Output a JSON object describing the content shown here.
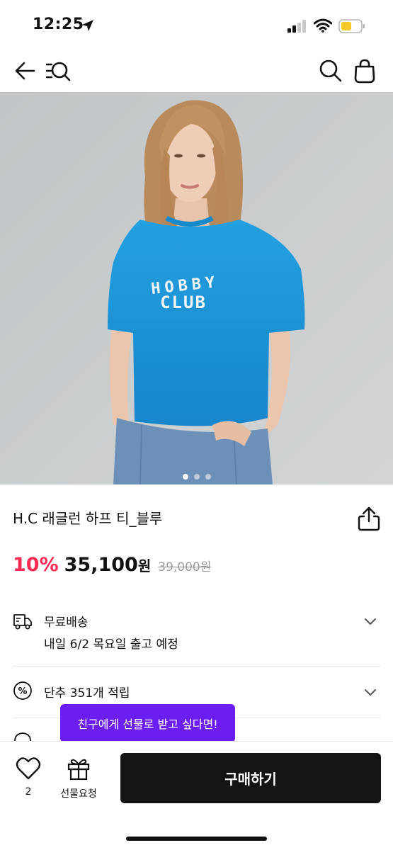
{
  "status_bar": {
    "time": "12:25",
    "battery_color": "#f6c928"
  },
  "nav": {
    "back_icon": "arrow-left-icon",
    "menu_search_icon": "menu-search-icon",
    "search_icon": "search-icon",
    "bag_icon": "shopping-bag-icon"
  },
  "product": {
    "image_text_line1": "HOBBY",
    "image_text_line2": "CLUB",
    "image_page_count": 3,
    "image_active_index": 0,
    "title": "H.C 래글런 하프 티_블루",
    "discount": "10%",
    "price": "35,100",
    "price_unit": "원",
    "original_price": "39,000원",
    "discount_color": "#ff2b55"
  },
  "shipping": {
    "icon": "truck-icon",
    "title": "무료배송",
    "subtitle": "내일 6/2 목요일 출고 예정"
  },
  "points": {
    "icon": "percent-icon",
    "title": "단추 351개 적립"
  },
  "tooltip": {
    "text": "친구에게 선물로 받고 싶다면!",
    "color": "#6c1df0"
  },
  "bottom_bar": {
    "like_icon": "heart-icon",
    "like_count": "2",
    "gift_icon": "gift-icon",
    "gift_label": "선물요청",
    "buy_label": "구매하기"
  }
}
